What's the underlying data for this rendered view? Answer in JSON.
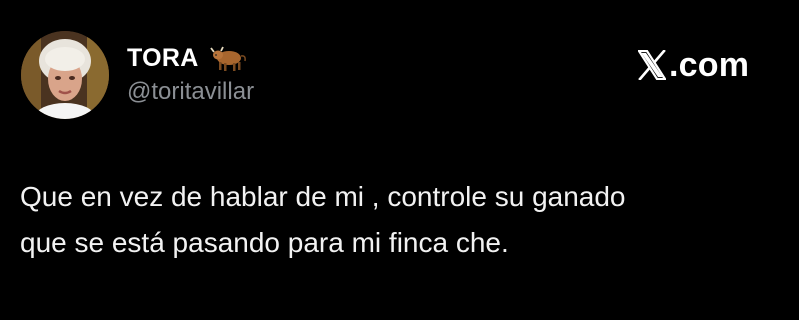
{
  "author": {
    "display_name": "TORA",
    "name_emoji": "ox-emoji",
    "handle": "@toritavillar",
    "avatar": "profile-photo"
  },
  "source": {
    "logo_icon": "x-logo-icon",
    "domain_suffix": ".com"
  },
  "tweet": {
    "lines": [
      "Que en vez de hablar de mi , controle su ganado",
      "que se está pasando para mi finca che."
    ]
  },
  "colors": {
    "background": "#000000",
    "name_text": "#ffffff",
    "handle_text": "#8b8f94",
    "body_text": "#f2f2f2"
  }
}
